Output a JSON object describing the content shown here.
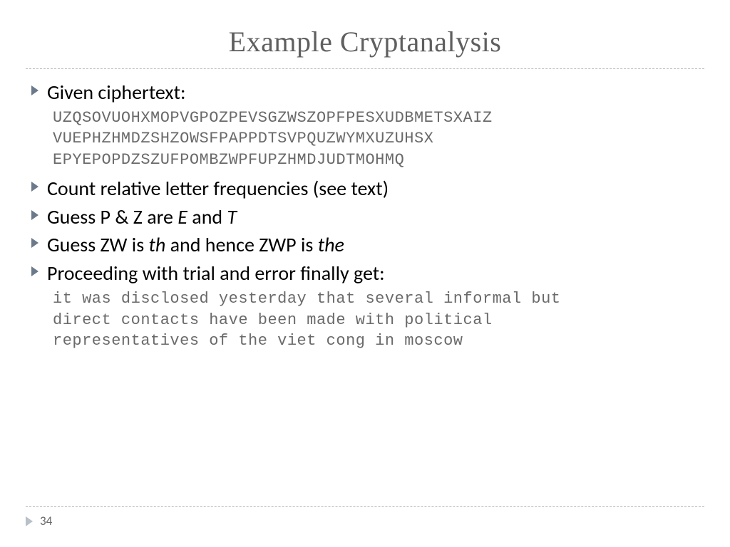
{
  "title": "Example Cryptanalysis",
  "bullets": {
    "b0": "Given ciphertext:",
    "cipher_lines": [
      "UZQSOVUOHXMOPVGPOZPEVSGZWSZOPFPESXUDBMETSXAIZ",
      "VUEPHZHMDZSHZOWSFPAPPDTSVPQUZWYMXUZUHSX",
      "EPYEPOPDZSZUFPOMBZWPFUPZHMDJUDTMOHMQ"
    ],
    "b1": "Count relative letter frequencies (see text)",
    "b2_pre": "Guess P & Z are ",
    "b2_i1": "E",
    "b2_mid": " and ",
    "b2_i2": "T",
    "b3_pre": "Guess ZW is ",
    "b3_i1": "th",
    "b3_mid": " and hence ZWP is ",
    "b3_i2": "the",
    "b4": "Proceeding with trial and error finally get:",
    "plain_lines": [
      "it was disclosed yesterday that several informal but",
      "direct contacts have been made with political",
      "representatives of the viet cong in moscow"
    ]
  },
  "page_number": "34",
  "colors": {
    "title": "#5f5f5f",
    "mono": "#6a6a6a",
    "bullet_arrow": "#6a7a8a"
  }
}
